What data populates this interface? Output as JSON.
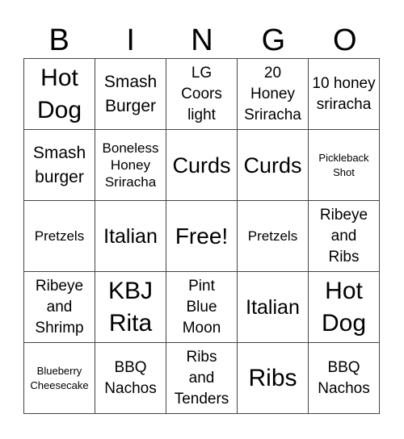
{
  "header": [
    "B",
    "I",
    "N",
    "G",
    "O"
  ],
  "cells": [
    [
      "Hot Dog",
      "Smash Burger",
      "LG Coors light",
      "20 Honey Sriracha",
      "10 honey sriracha"
    ],
    [
      "Smash burger",
      "Boneless Honey Sriracha",
      "Curds",
      "Curds",
      "Pickleback Shot"
    ],
    [
      "Pretzels",
      "Italian",
      "Free!",
      "Pretzels",
      "Ribeye and Ribs"
    ],
    [
      "Ribeye and Shrimp",
      "KBJ Rita",
      "Pint Blue Moon",
      "Italian",
      "Hot Dog"
    ],
    [
      "Blueberry Cheesecake",
      "BBQ Nachos",
      "Ribs and Tenders",
      "Ribs",
      "BBQ Nachos"
    ]
  ]
}
